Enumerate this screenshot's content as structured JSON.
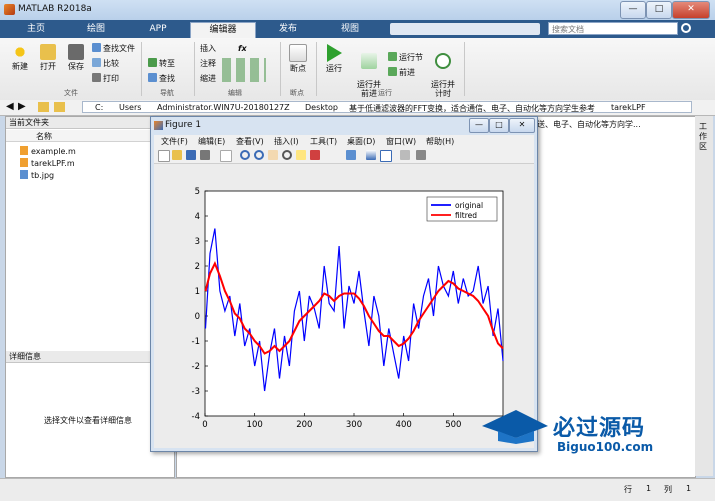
{
  "app": {
    "title": "MATLAB R2018a"
  },
  "window_controls": {
    "minimize": "—",
    "maximize": "□",
    "close": "✕"
  },
  "tabs": [
    {
      "label": "主页"
    },
    {
      "label": "绘图"
    },
    {
      "label": "APP"
    },
    {
      "label": "编辑器"
    },
    {
      "label": "发布"
    },
    {
      "label": "视图"
    }
  ],
  "search": {
    "placeholder": "搜索文档"
  },
  "ribbon": {
    "file": {
      "new": "新建",
      "open": "打开",
      "save": "保存",
      "find_files": "查找文件",
      "compare": "比较",
      "print": "打印",
      "group": "文件"
    },
    "nav": {
      "go_to": "转至",
      "find": "查找",
      "group": "导航"
    },
    "edit": {
      "insert": "插入",
      "comment": "注释",
      "indent": "缩进",
      "fx": "fx",
      "group": "编辑"
    },
    "breakpoints": {
      "label": "断点",
      "group": "断点"
    },
    "run": {
      "run": "运行",
      "run_advance": "运行并\n前进",
      "run_section": "运行节",
      "advance": "前进",
      "run_time": "运行并\n计时",
      "group": "运行"
    }
  },
  "address": {
    "drive": "C:",
    "crumbs": [
      "Users",
      "Administrator.WIN7U-20180127Z",
      "Desktop",
      "基于低通滤波器的FFT变换，适合通信、电子、自动化等方向学生参考",
      "tarekLPF"
    ]
  },
  "left_panel": {
    "header": "当前文件夹",
    "column_name": "名称",
    "files": [
      "example.m",
      "tarekLPF.m",
      "tb.jpg"
    ],
    "details_header": "详细信息",
    "details_hint": "选择文件以查看详细信息"
  },
  "background_text": {
    "path_tail": "送、电子、自动化等方向学...",
    "right_dock": "工作区"
  },
  "status": {
    "row_label": "行",
    "row_value": "1",
    "col_label": "列",
    "col_value": "1"
  },
  "figure": {
    "title": "Figure 1",
    "menu": [
      "文件(F)",
      "编辑(E)",
      "查看(V)",
      "插入(I)",
      "工具(T)",
      "桌面(D)",
      "窗口(W)",
      "帮助(H)"
    ]
  },
  "chart_data": {
    "type": "line",
    "xlim": [
      0,
      600
    ],
    "ylim": [
      -4,
      5
    ],
    "x_ticks": [
      0,
      100,
      200,
      300,
      400,
      500
    ],
    "y_ticks": [
      -4,
      -3,
      -2,
      -1,
      0,
      1,
      2,
      3,
      4,
      5
    ],
    "legend_position": "top-right",
    "grid": false,
    "series": [
      {
        "name": "original",
        "color": "#0000ff",
        "x": [
          1,
          10,
          20,
          30,
          40,
          50,
          60,
          70,
          80,
          90,
          100,
          110,
          120,
          130,
          140,
          150,
          160,
          170,
          180,
          190,
          200,
          210,
          220,
          230,
          240,
          250,
          260,
          270,
          280,
          290,
          300,
          310,
          320,
          330,
          340,
          350,
          360,
          370,
          380,
          390,
          400,
          410,
          420,
          430,
          440,
          450,
          460,
          470,
          480,
          490,
          500,
          510,
          520,
          530,
          540,
          550,
          560,
          570,
          580,
          590,
          600
        ],
        "y": [
          -0.5,
          2.5,
          3.5,
          1.0,
          0.2,
          0.8,
          -0.8,
          0.5,
          -1.2,
          -0.5,
          -2.0,
          -1.0,
          -3.0,
          -1.5,
          -0.5,
          -2.5,
          -0.8,
          -2.0,
          0.2,
          1.0,
          -1.0,
          0.8,
          0.3,
          -0.5,
          2.0,
          0.5,
          0.2,
          2.8,
          -0.5,
          1.2,
          0.5,
          1.8,
          0.2,
          -1.2,
          0.8,
          0.0,
          -2.0,
          -0.5,
          -1.5,
          -2.5,
          -0.8,
          -1.8,
          0.5,
          -0.5,
          0.8,
          1.5,
          0.0,
          2.0,
          1.2,
          0.8,
          1.8,
          0.5,
          1.5,
          0.8,
          1.0,
          2.0,
          0.5,
          1.2,
          -0.8,
          0.3,
          -1.8
        ]
      },
      {
        "name": "filtred",
        "color": "#ff0000",
        "x": [
          1,
          10,
          20,
          30,
          40,
          50,
          60,
          70,
          80,
          90,
          100,
          110,
          120,
          130,
          140,
          150,
          160,
          170,
          180,
          190,
          200,
          210,
          220,
          230,
          240,
          250,
          260,
          270,
          280,
          290,
          300,
          310,
          320,
          330,
          340,
          350,
          360,
          370,
          380,
          390,
          400,
          410,
          420,
          430,
          440,
          450,
          460,
          470,
          480,
          490,
          500,
          510,
          520,
          530,
          540,
          550,
          560,
          570,
          580,
          590,
          600
        ],
        "y": [
          1.0,
          1.7,
          2.1,
          1.6,
          1.0,
          0.6,
          0.1,
          -0.1,
          -0.5,
          -0.7,
          -1.0,
          -1.2,
          -1.5,
          -1.4,
          -1.2,
          -1.4,
          -1.2,
          -1.0,
          -0.6,
          -0.2,
          0.0,
          0.2,
          0.4,
          0.6,
          0.9,
          0.8,
          0.6,
          0.8,
          0.9,
          0.9,
          0.9,
          0.7,
          0.4,
          0.0,
          -0.3,
          -0.6,
          -0.8,
          -0.8,
          -1.0,
          -1.2,
          -1.1,
          -0.9,
          -0.6,
          -0.2,
          0.1,
          0.4,
          0.7,
          1.0,
          1.2,
          1.4,
          1.3,
          1.1,
          1.0,
          0.9,
          0.8,
          0.6,
          0.3,
          0.0,
          -0.6,
          -1.1,
          -1.3
        ]
      }
    ]
  },
  "watermark": {
    "text": "必过源码",
    "url": "Biguo100.com"
  }
}
